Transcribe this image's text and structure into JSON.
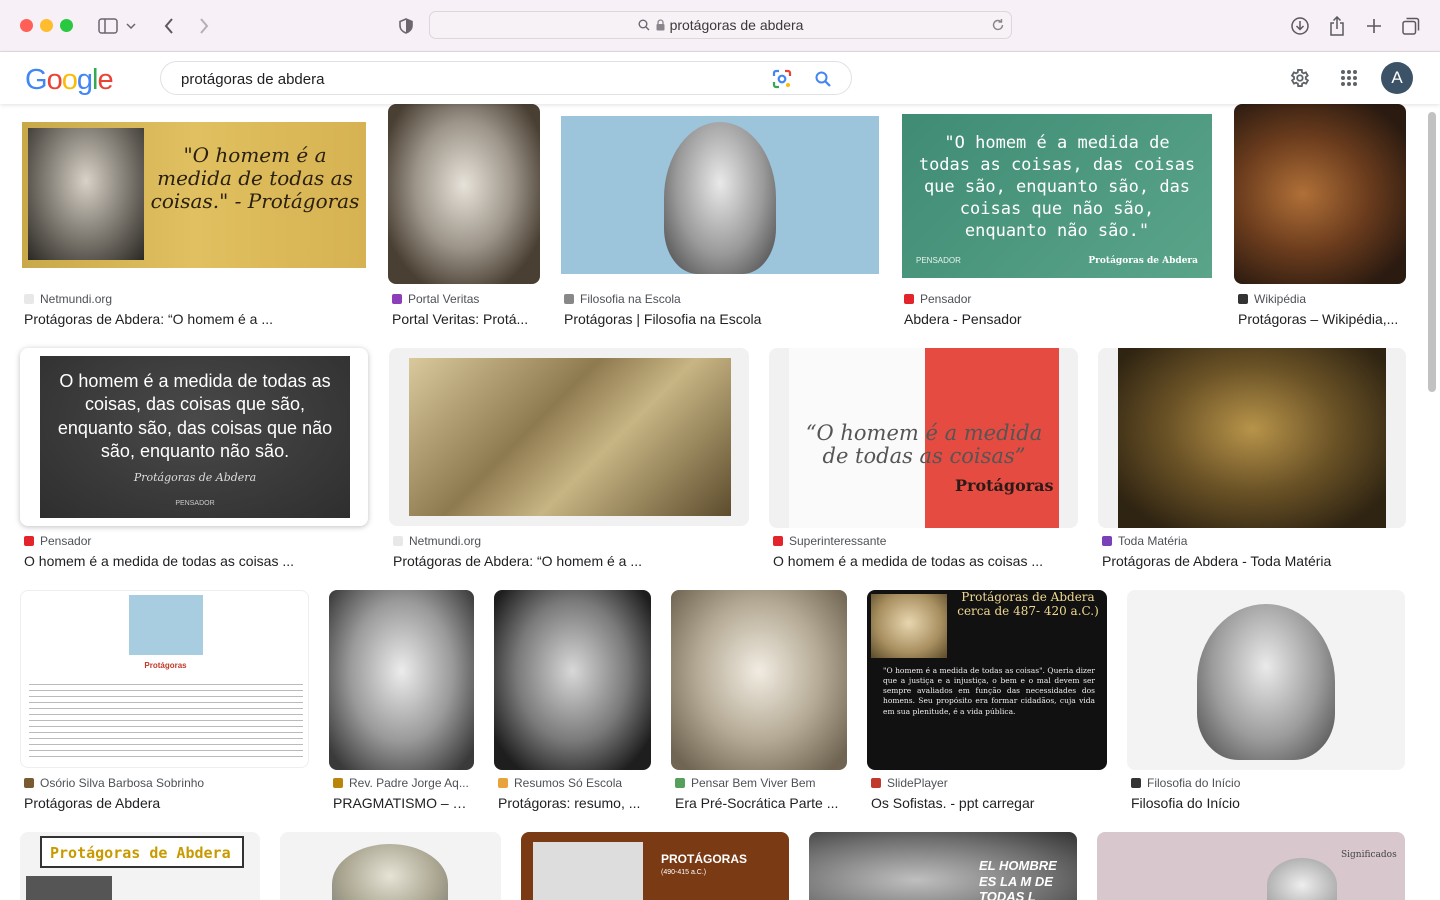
{
  "browser": {
    "url": "protágoras de abdera"
  },
  "google": {
    "logo_letters": [
      "G",
      "o",
      "o",
      "g",
      "l",
      "e"
    ],
    "logo_colors": [
      "#4285F4",
      "#EA4335",
      "#FBBC05",
      "#4285F4",
      "#34A853",
      "#EA4335"
    ],
    "query": "protágoras de abdera",
    "avatar_letter": "A"
  },
  "results": [
    {
      "source": "Netmundi.org",
      "title": "Protágoras de Abdera: “O homem é a ...",
      "caption": "\"O homem é a medida de todas as coisas.\" - Protágoras"
    },
    {
      "source": "Portal Veritas",
      "title": "Portal Veritas: Protá..."
    },
    {
      "source": "Filosofia na Escola",
      "title": "Protágoras | Filosofia na Escola"
    },
    {
      "source": "Pensador",
      "title": "Abdera - Pensador",
      "caption": "\"O homem é a medida de todas as coisas, das coisas que são, enquanto são, das coisas que não são, enquanto não são.\"",
      "footer_left": "PENSADOR",
      "footer_right": "Protágoras de Abdera"
    },
    {
      "source": "Wikipédia",
      "title": "Protágoras – Wikipédia,..."
    },
    {
      "source": "Pensador",
      "title": "O homem é a medida de todas as coisas ...",
      "caption": "O homem é a medida de todas as coisas, das coisas que são, enquanto são, das coisas que não são, enquanto não são.",
      "sign": "Protágoras de Abdera",
      "footer_left": "PENSADOR"
    },
    {
      "source": "Netmundi.org",
      "title": "Protágoras de Abdera: “O homem é a ..."
    },
    {
      "source": "Superinteressante",
      "title": "O homem é a medida de todas as coisas ...",
      "caption": "“O homem é a medida de todas as coisas”",
      "sign": "Protágoras"
    },
    {
      "source": "Toda Matéria",
      "title": "Protágoras de Abdera - Toda Matéria"
    },
    {
      "source": "Osório Silva Barbosa Sobrinho",
      "title": "Protágoras de Abdera",
      "caption": "Protágoras"
    },
    {
      "source": "Rev. Padre Jorge Aq...",
      "title": "PRAGMATISMO – R..."
    },
    {
      "source": "Resumos Só Escola",
      "title": "Protágoras: resumo, ..."
    },
    {
      "source": "Pensar Bem Viver Bem",
      "title": "Era Pré-Socrática Parte ..."
    },
    {
      "source": "SlidePlayer",
      "title": "Os Sofistas. - ppt carregar",
      "caption": "Protágoras de Abdera cerca de 487- 420 a.C.)",
      "body": "\"O homem é a medida de todas as coisas\". Queria dizer que a justiça e a injustiça, o bem e o mal devem ser sempre avaliados em função das necessidades dos homens. Seu propósito era formar cidadãos, cuja vida em sua plenitude, é a vida pública."
    },
    {
      "source": "Filosofia do Início",
      "title": "Filosofia do Início"
    }
  ],
  "partial_row": [
    {
      "caption": "Protágoras de Abdera"
    },
    {
      "caption": ""
    },
    {
      "caption": "PROTÁGORAS",
      "sub": "(490-415 a.C.)"
    },
    {
      "caption": "EL HOMBRE ES LA M DE TODAS L"
    },
    {
      "caption": "Significados"
    }
  ]
}
